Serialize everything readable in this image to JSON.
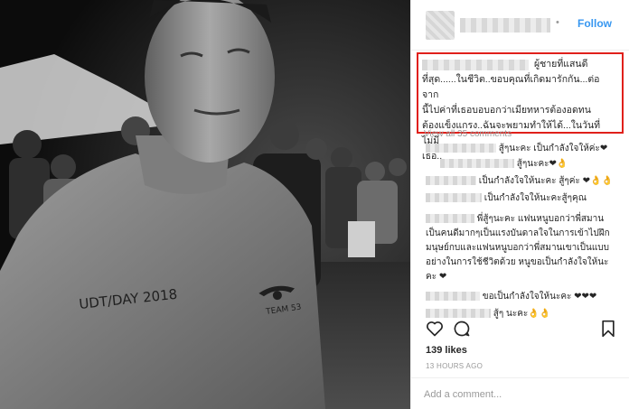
{
  "header": {
    "separator": "•",
    "follow_label": "Follow"
  },
  "caption": {
    "line1": "ผู้ชายที่แสนดี",
    "lines": [
      "ที่สุด......ในชีวิต..ขอบคุณที่เกิดมารักกัน...ต่อจาก",
      "นี้ไปค่าที่เธอบอบอกว่าเมียทหารต้องอดทน",
      "ต้องแข็งแกรง..ฉันจะพยามทำให้ได้...ในวันที่ไม่มี",
      "เธอ.."
    ],
    "highlight_color": "#e0201b"
  },
  "view_all": "View all 35 comments",
  "comments": [
    {
      "text": "สู้ๆนะคะ เป็นกำลังใจให้ค่ะ❤"
    },
    {
      "text": "สู้ๆนะคะ❤👌"
    },
    {
      "text": "เป็นกำลังใจให้นะคะ สู้ๆค่ะ ❤👌👌"
    },
    {
      "text": "เป็นกำลังใจให้นะคะสู้ๆคุณ"
    },
    {
      "text": "พี่สู้ๆนะคะ แฟนหนูบอกว่าพี่สมาน"
    },
    {
      "text": "เป็นคนดีมากๆเป็นแรงบันดาลใจในการเข้าไปฝึก"
    },
    {
      "text": "มนุษย์กบและแฟนหนูบอกว่าพี่สมานเขาเป็นแบบ"
    },
    {
      "text": "อย่างในการใช้ชีวิตด้วย หนูขอเป็นกำลังใจให้นะ"
    },
    {
      "text": "คะ ❤"
    },
    {
      "text": "ขอเป็นกำลังใจให้นะคะ ❤❤❤"
    },
    {
      "text": "สู้ๆ นะคะ👌👌"
    }
  ],
  "likes": "139 likes",
  "timestamp": "13 HOURS AGO",
  "add_comment_placeholder": "Add a comment...",
  "photo": {
    "shirt_text": "UDT/DAY 2018",
    "badge_text": "TEAM 53"
  },
  "icons": [
    "heart-icon",
    "comment-icon",
    "bookmark-icon",
    "more-options-icon"
  ]
}
